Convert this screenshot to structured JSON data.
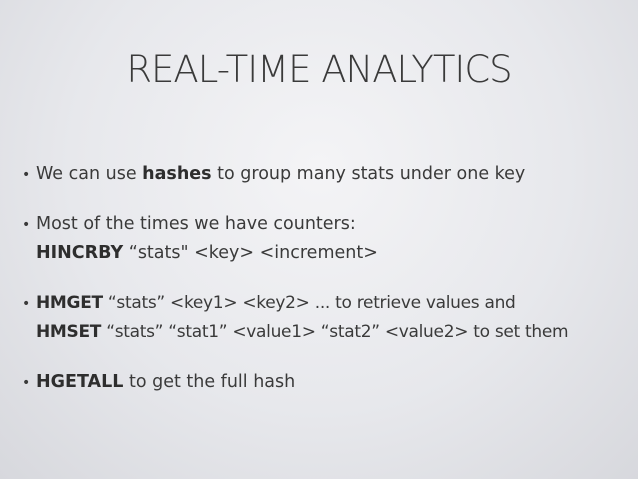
{
  "slide": {
    "title": "REAL-TIME ANALYTICS",
    "bullet_symbol": "•",
    "bullets": [
      {
        "lines": [
          {
            "parts": [
              {
                "text": "We can use ",
                "bold": false
              },
              {
                "text": "hashes",
                "bold": true
              },
              {
                "text": " to group many stats under one key",
                "bold": false
              }
            ]
          }
        ]
      },
      {
        "lines": [
          {
            "parts": [
              {
                "text": "Most of the times we have counters:",
                "bold": false
              }
            ]
          },
          {
            "parts": [
              {
                "text": "HINCRBY",
                "bold": true
              },
              {
                "text": " “stats\" <key> <increment>",
                "bold": false
              }
            ]
          }
        ]
      },
      {
        "lines": [
          {
            "parts": [
              {
                "text": "HMGET",
                "bold": true
              },
              {
                "text": " “stats” <key1> <key2> ... to retrieve values and",
                "bold": false
              }
            ]
          },
          {
            "parts": [
              {
                "text": "HMSET",
                "bold": true
              },
              {
                "text": " “stats” “stat1” <value1> “stat2” <value2> to set them",
                "bold": false
              }
            ]
          }
        ]
      },
      {
        "lines": [
          {
            "parts": [
              {
                "text": "HGETALL",
                "bold": true
              },
              {
                "text": " to get the full hash",
                "bold": false
              }
            ]
          }
        ]
      }
    ]
  }
}
